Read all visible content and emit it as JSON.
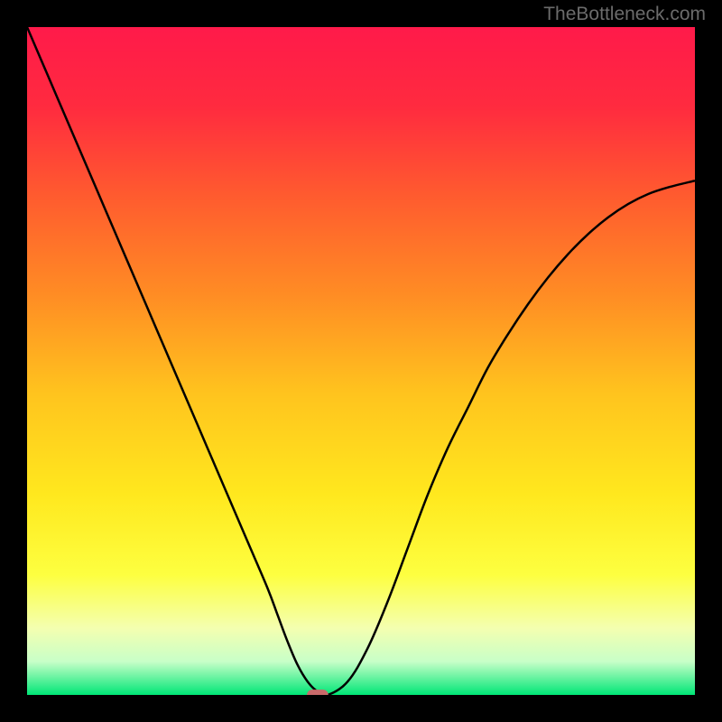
{
  "watermark": "TheBottleneck.com",
  "chart_data": {
    "type": "line",
    "title": "",
    "xlabel": "",
    "ylabel": "",
    "xlim": [
      0,
      100
    ],
    "ylim": [
      0,
      100
    ],
    "background_gradient": {
      "stops": [
        {
          "offset": 0,
          "color": "#ff1a4a"
        },
        {
          "offset": 0.12,
          "color": "#ff2b3f"
        },
        {
          "offset": 0.25,
          "color": "#ff5a2f"
        },
        {
          "offset": 0.4,
          "color": "#ff8c24"
        },
        {
          "offset": 0.55,
          "color": "#ffc41e"
        },
        {
          "offset": 0.7,
          "color": "#ffe81e"
        },
        {
          "offset": 0.82,
          "color": "#fdff40"
        },
        {
          "offset": 0.9,
          "color": "#f4ffb0"
        },
        {
          "offset": 0.95,
          "color": "#c8ffc8"
        },
        {
          "offset": 1.0,
          "color": "#00e676"
        }
      ]
    },
    "curve": {
      "x": [
        0,
        3,
        6,
        9,
        12,
        15,
        18,
        21,
        24,
        27,
        30,
        33,
        36,
        37.5,
        39,
        40.5,
        42,
        43.5,
        45,
        48,
        51,
        54,
        57,
        60,
        63,
        66,
        69,
        72,
        75,
        78,
        81,
        84,
        87,
        90,
        93,
        96,
        100
      ],
      "y": [
        100,
        93,
        86,
        79,
        72,
        65,
        58,
        51,
        44,
        37,
        30,
        23,
        16,
        12,
        8,
        4.5,
        2,
        0.5,
        0,
        2,
        7,
        14,
        22,
        30,
        37,
        43,
        49,
        54,
        58.5,
        62.5,
        66,
        69,
        71.5,
        73.5,
        75,
        76,
        77
      ]
    },
    "marker": {
      "x": 43.5,
      "y": 0,
      "color": "#c96a6a",
      "width": 3.2,
      "height": 1.6
    }
  }
}
